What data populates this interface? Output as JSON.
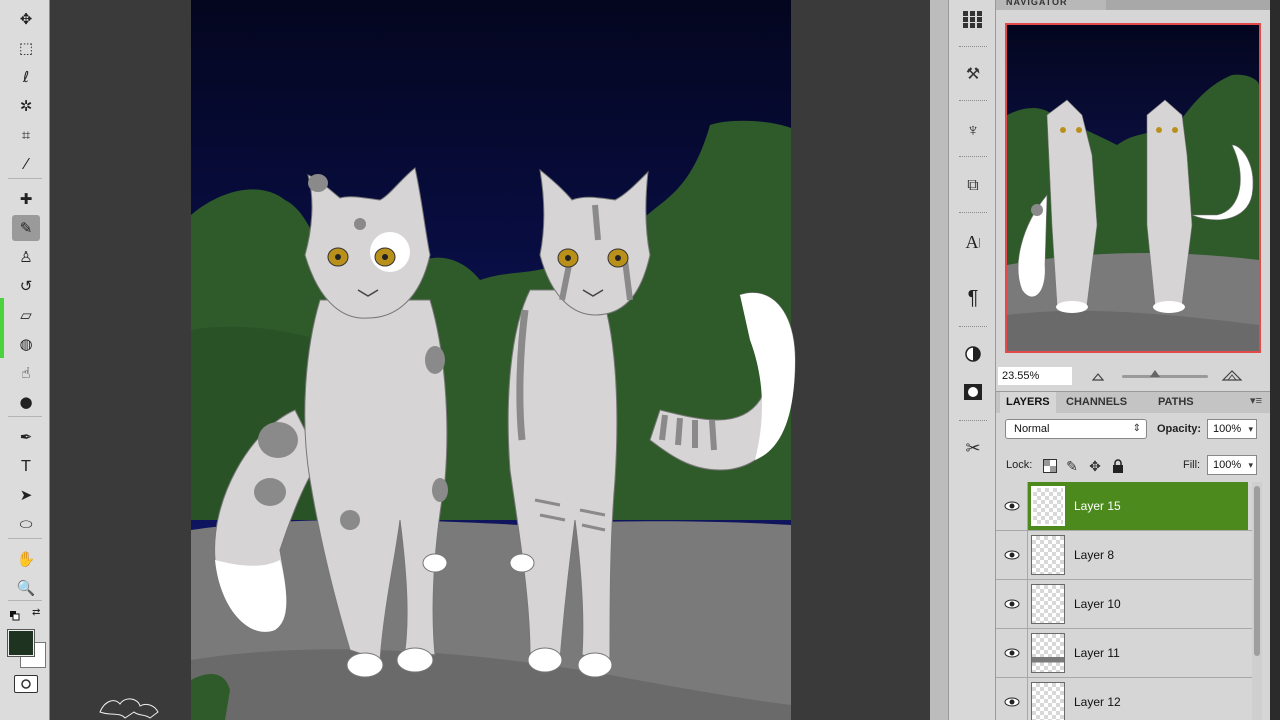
{
  "toolbar": {
    "tools": [
      {
        "name": "move-tool",
        "glyph": "✥"
      },
      {
        "name": "marquee-tool",
        "glyph": "⬚"
      },
      {
        "name": "lasso-tool",
        "glyph": "ℓ"
      },
      {
        "name": "quick-selection-tool",
        "glyph": "✲"
      },
      {
        "name": "crop-tool",
        "glyph": "⌗"
      },
      {
        "name": "eyedropper-tool",
        "glyph": "⁄"
      },
      {
        "name": "healing-brush-tool",
        "glyph": "✚"
      },
      {
        "name": "brush-tool",
        "glyph": "✎"
      },
      {
        "name": "clone-stamp-tool",
        "glyph": "♙"
      },
      {
        "name": "history-brush-tool",
        "glyph": "↺"
      },
      {
        "name": "eraser-tool",
        "glyph": "▱"
      },
      {
        "name": "paint-bucket-tool",
        "glyph": "◍"
      },
      {
        "name": "smudge-tool",
        "glyph": "☝"
      },
      {
        "name": "dodge-tool",
        "glyph": "●"
      },
      {
        "name": "pen-tool",
        "glyph": "✒"
      },
      {
        "name": "type-tool",
        "glyph": "T"
      },
      {
        "name": "path-selection-tool",
        "glyph": "➤"
      },
      {
        "name": "ellipse-tool",
        "glyph": "⬭"
      },
      {
        "name": "hand-tool",
        "glyph": "✋"
      },
      {
        "name": "zoom-tool",
        "glyph": "🔍"
      }
    ],
    "active_tool": "brush-tool",
    "foreground_color": "#1e3320",
    "background_color": "#ffffff"
  },
  "navigator": {
    "tab_label": "NAVIGATOR",
    "zoom_value": "23.55%"
  },
  "layers_panel": {
    "tabs": [
      "LAYERS",
      "CHANNELS",
      "PATHS"
    ],
    "active_tab": "LAYERS",
    "blend_mode": "Normal",
    "opacity_label": "Opacity:",
    "opacity_value": "100%",
    "lock_label": "Lock:",
    "fill_label": "Fill:",
    "fill_value": "100%",
    "layers": [
      {
        "name": "Layer 15",
        "selected": true
      },
      {
        "name": "Layer 8",
        "selected": false
      },
      {
        "name": "Layer 10",
        "selected": false
      },
      {
        "name": "Layer 11",
        "selected": false
      },
      {
        "name": "Layer 12",
        "selected": false
      }
    ]
  },
  "colors": {
    "selected_layer": "#4c8a1e",
    "sky_top": "#070a2e",
    "trees": "#2f5a2a",
    "ground": "#7a7a7a",
    "cat_fur": "#d6d4d4"
  }
}
